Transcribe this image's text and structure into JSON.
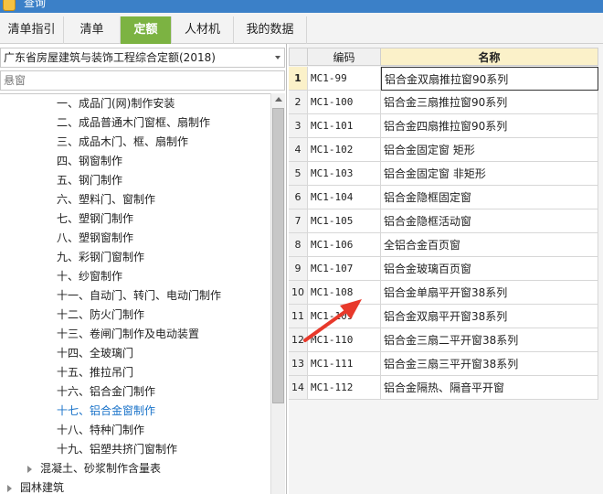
{
  "window": {
    "title": "查询"
  },
  "tabs": [
    {
      "label": "清单指引",
      "active": false
    },
    {
      "label": "清单",
      "active": false
    },
    {
      "label": "定额",
      "active": true
    },
    {
      "label": "人材机",
      "active": false
    },
    {
      "label": "我的数据",
      "active": false
    }
  ],
  "left": {
    "quota_select": "广东省房屋建筑与装饰工程综合定额(2018)",
    "search_placeholder": "悬窗",
    "tree": [
      {
        "label": "一、成品门(网)制作安装",
        "selected": false
      },
      {
        "label": "二、成品普通木门窗框、扇制作",
        "selected": false
      },
      {
        "label": "三、成品木门、框、扇制作",
        "selected": false
      },
      {
        "label": "四、钢窗制作",
        "selected": false
      },
      {
        "label": "五、钢门制作",
        "selected": false
      },
      {
        "label": "六、塑料门、窗制作",
        "selected": false
      },
      {
        "label": "七、塑钢门制作",
        "selected": false
      },
      {
        "label": "八、塑钢窗制作",
        "selected": false
      },
      {
        "label": "九、彩钢门窗制作",
        "selected": false
      },
      {
        "label": "十、纱窗制作",
        "selected": false
      },
      {
        "label": "十一、自动门、转门、电动门制作",
        "selected": false
      },
      {
        "label": "十二、防火门制作",
        "selected": false
      },
      {
        "label": "十三、卷闸门制作及电动装置",
        "selected": false
      },
      {
        "label": "十四、全玻璃门",
        "selected": false
      },
      {
        "label": "十五、推拉吊门",
        "selected": false
      },
      {
        "label": "十六、铝合金门制作",
        "selected": false
      },
      {
        "label": "十七、铝合金窗制作",
        "selected": true
      },
      {
        "label": "十八、特种门制作",
        "selected": false
      },
      {
        "label": "十九、铝塑共挤门窗制作",
        "selected": false
      }
    ],
    "top_items": [
      {
        "label": "混凝土、砂浆制作含量表"
      },
      {
        "label": "园林建筑"
      }
    ]
  },
  "grid": {
    "headers": {
      "code": "编码",
      "name": "名称"
    },
    "rows": [
      {
        "num": "1",
        "code": "MC1-99",
        "name": "铝合金双扇推拉窗90系列"
      },
      {
        "num": "2",
        "code": "MC1-100",
        "name": "铝合金三扇推拉窗90系列"
      },
      {
        "num": "3",
        "code": "MC1-101",
        "name": "铝合金四扇推拉窗90系列"
      },
      {
        "num": "4",
        "code": "MC1-102",
        "name": "铝合金固定窗 矩形"
      },
      {
        "num": "5",
        "code": "MC1-103",
        "name": "铝合金固定窗 非矩形"
      },
      {
        "num": "6",
        "code": "MC1-104",
        "name": "铝合金隐框固定窗"
      },
      {
        "num": "7",
        "code": "MC1-105",
        "name": "铝合金隐框活动窗"
      },
      {
        "num": "8",
        "code": "MC1-106",
        "name": "全铝合金百页窗"
      },
      {
        "num": "9",
        "code": "MC1-107",
        "name": "铝合金玻璃百页窗"
      },
      {
        "num": "10",
        "code": "MC1-108",
        "name": "铝合金单扇平开窗38系列"
      },
      {
        "num": "11",
        "code": "MC1-109",
        "name": "铝合金双扇平开窗38系列"
      },
      {
        "num": "12",
        "code": "MC1-110",
        "name": "铝合金三扇二平开窗38系列"
      },
      {
        "num": "13",
        "code": "MC1-111",
        "name": "铝合金三扇三平开窗38系列"
      },
      {
        "num": "14",
        "code": "MC1-112",
        "name": "铝合金隔热、隔音平开窗"
      }
    ]
  },
  "annotation": {
    "color": "#e8392b"
  },
  "colors": {
    "active_tab": "#7cb342",
    "selected_tree_item": "#1a73c9",
    "title_bar": "#3b80c8"
  }
}
